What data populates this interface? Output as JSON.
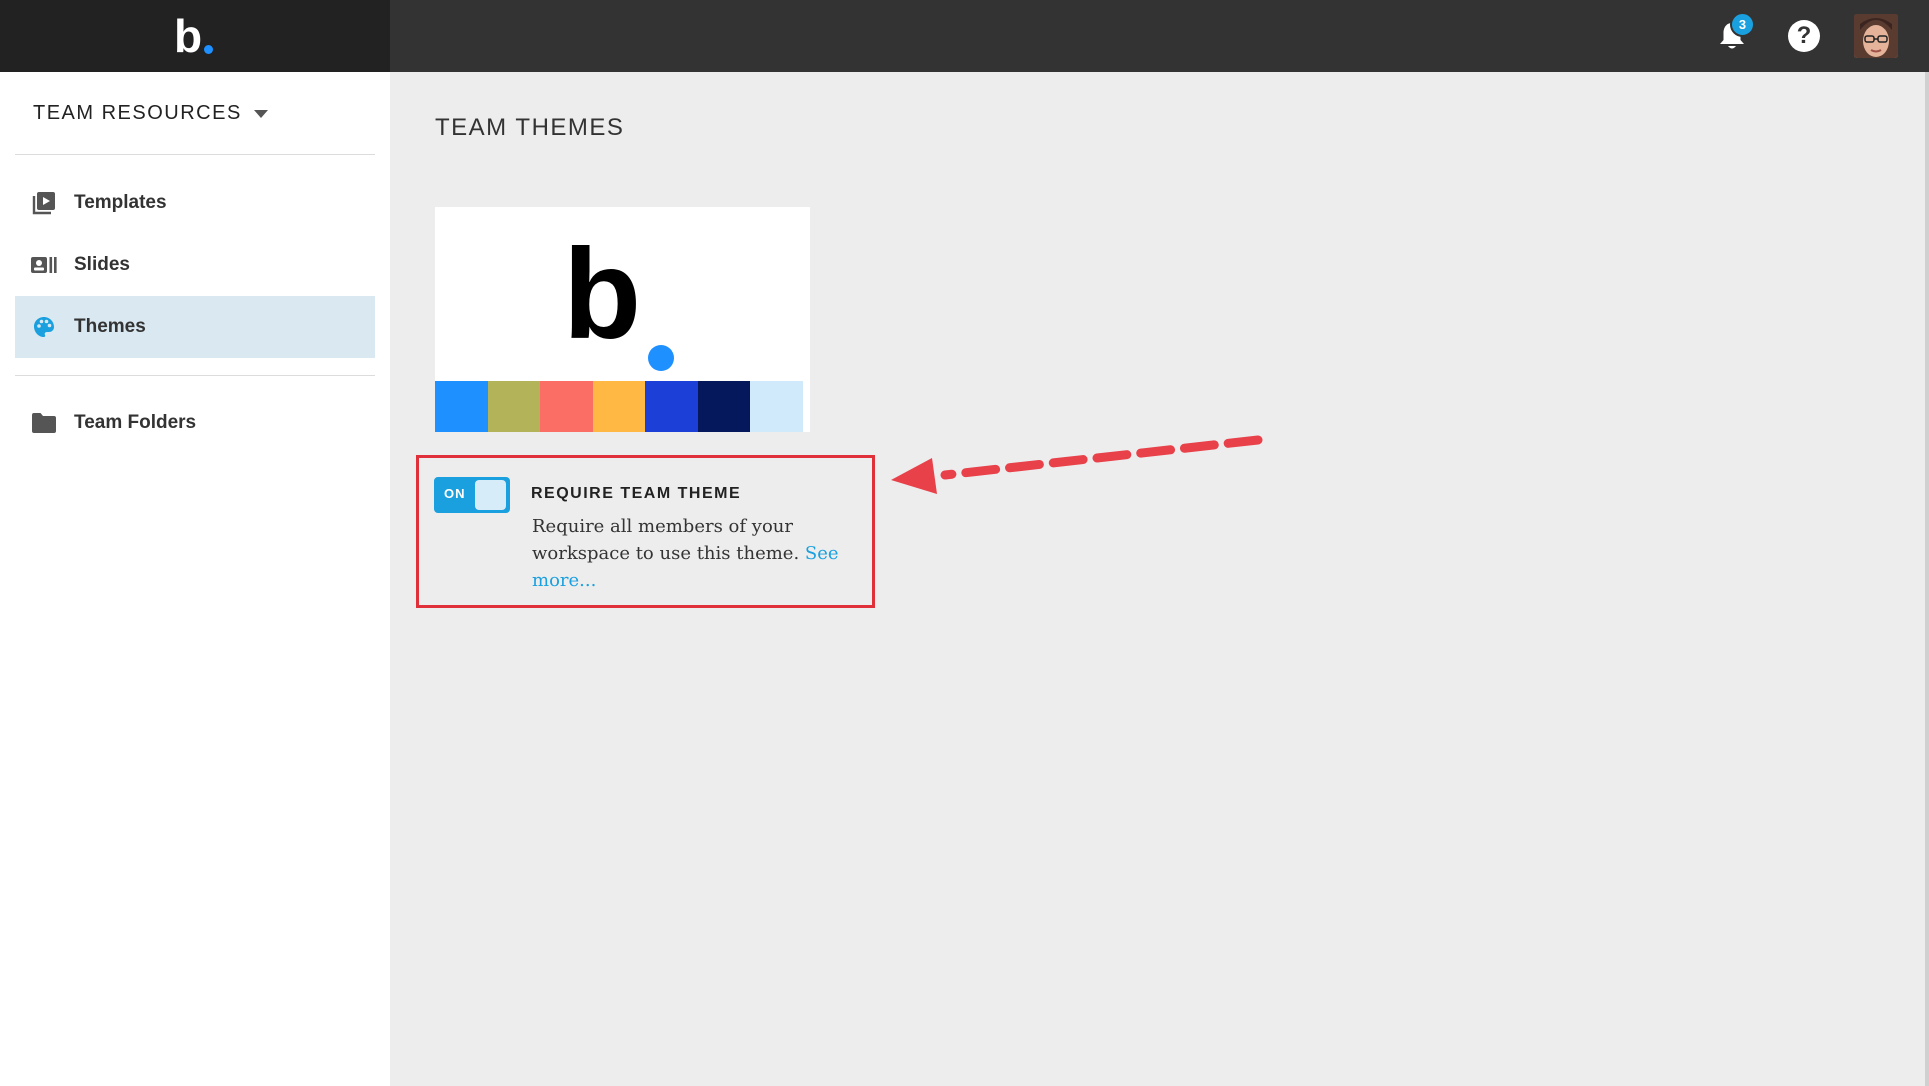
{
  "topbar": {
    "logo_text": "b",
    "notifications_count": "3",
    "help_symbol": "?",
    "icons": {
      "bell": "bell-icon",
      "help": "help-icon",
      "avatar": "user-avatar"
    }
  },
  "sidebar": {
    "section_title": "TEAM RESOURCES",
    "items": [
      {
        "label": "Templates",
        "icon": "play-stack-icon",
        "active": false
      },
      {
        "label": "Slides",
        "icon": "slides-icon",
        "active": false
      },
      {
        "label": "Themes",
        "icon": "palette-icon",
        "active": true
      },
      {
        "label": "Team Folders",
        "icon": "folder-icon",
        "active": false
      }
    ]
  },
  "main": {
    "title": "TEAM THEMES",
    "theme_card": {
      "logo_text": "b",
      "palette": [
        "#1e90ff",
        "#b3b359",
        "#fa6e66",
        "#ffb843",
        "#1c3fd8",
        "#06185c",
        "#d0e9fb"
      ]
    },
    "require_theme": {
      "toggle_label": "ON",
      "toggle_on": true,
      "title": "REQUIRE TEAM THEME",
      "description": "Require all members of your workspace to use this theme.",
      "link_text": "See more..."
    }
  },
  "colors": {
    "accent": "#1aa0df",
    "annotation": "#e0313b",
    "topbar": "#333333"
  }
}
